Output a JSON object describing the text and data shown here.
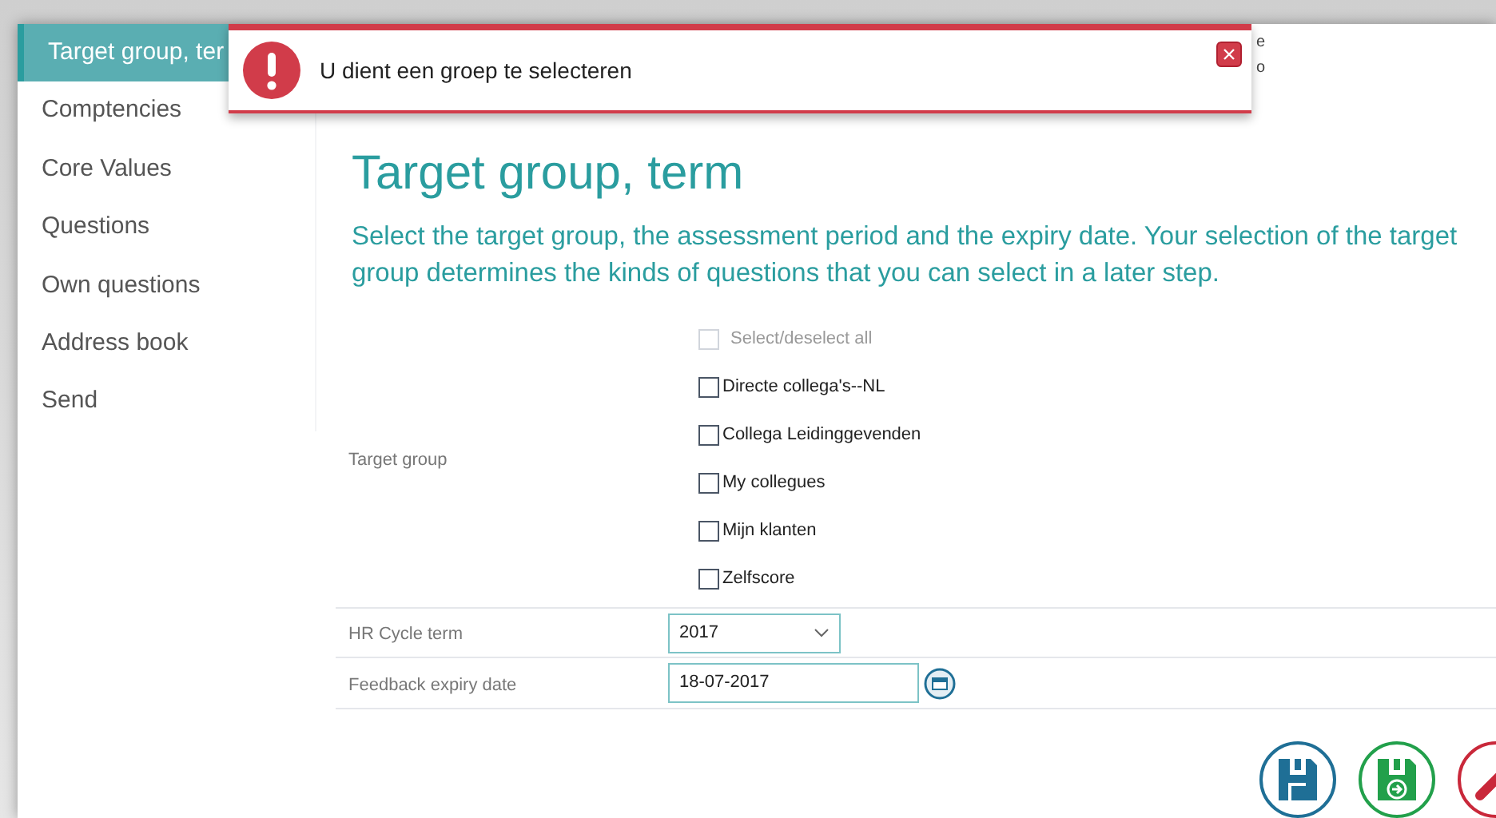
{
  "sidebar": {
    "items": [
      {
        "label": "Target group, ter",
        "selected": true
      },
      {
        "label": "Comptencies",
        "selected": false
      },
      {
        "label": "Core Values",
        "selected": false
      },
      {
        "label": "Questions",
        "selected": false
      },
      {
        "label": "Own questions",
        "selected": false
      },
      {
        "label": "Address book",
        "selected": false
      },
      {
        "label": "Send",
        "selected": false
      }
    ]
  },
  "header_fragments": [
    "e",
    "o"
  ],
  "title": "Target group, term",
  "description": "Select the target group, the assessment period and the expiry date. Your selection of the target group determines the kinds of questions that you can select in a later step.",
  "form": {
    "target_group": {
      "label": "Target group",
      "select_all": {
        "label": "Select/deselect all",
        "checked": false,
        "disabled": true
      },
      "options": [
        {
          "label": "Directe collega's--NL",
          "checked": false
        },
        {
          "label": "Collega Leidinggevenden",
          "checked": false
        },
        {
          "label": "My collegues",
          "checked": false
        },
        {
          "label": "Mijn klanten",
          "checked": false
        },
        {
          "label": "Zelfscore",
          "checked": false
        }
      ]
    },
    "hr_cycle_term": {
      "label": "HR Cycle term",
      "value": "2017"
    },
    "feedback_expiry_date": {
      "label": "Feedback expiry date",
      "value": "18-07-2017"
    }
  },
  "toast": {
    "message": "U dient een groep te selecteren"
  },
  "actions": [
    {
      "kind": "save"
    },
    {
      "kind": "save-next"
    },
    {
      "kind": "cancel"
    }
  ]
}
